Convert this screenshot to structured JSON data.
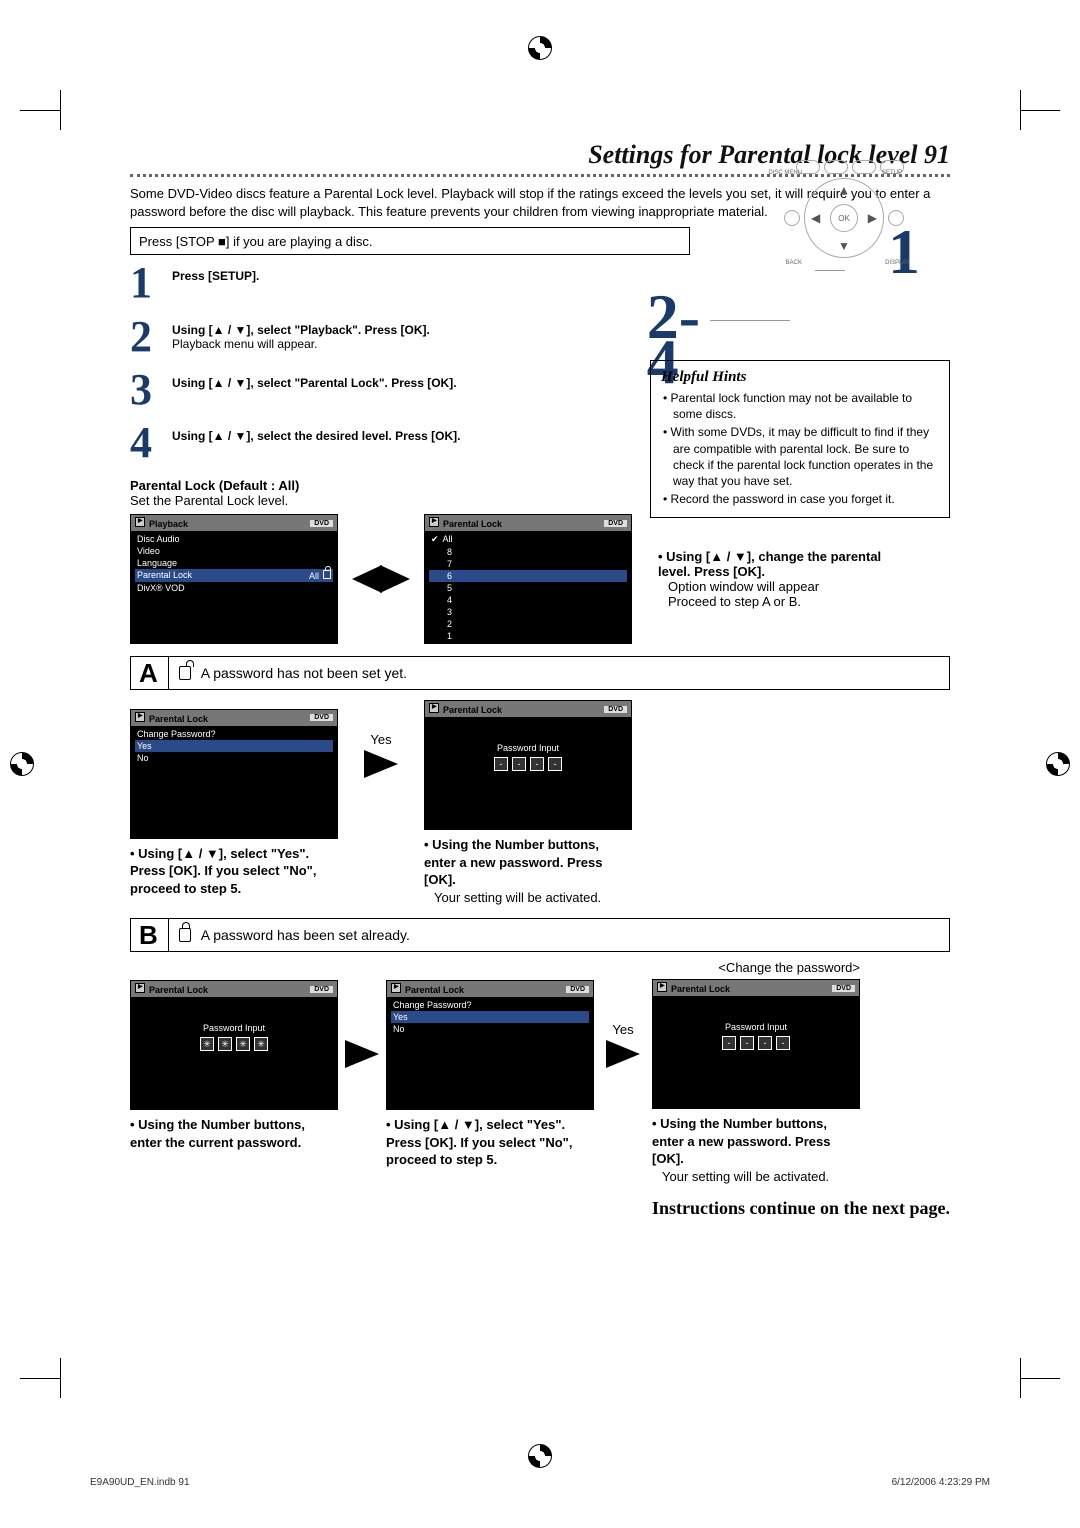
{
  "page_title": "Settings for Parental lock level  91",
  "intro": "Some DVD-Video discs feature a Parental Lock level. Playback will stop if the ratings exceed the levels you set, it will require you to enter a password before the disc will playback. This feature prevents your children from viewing inappropriate material.",
  "step_header": "Press [STOP ■] if you are playing a disc.",
  "steps": {
    "s1": {
      "num": "1",
      "title": "Press [SETUP].",
      "body": ""
    },
    "s2": {
      "num": "2",
      "title": "Using [▲ / ▼], select \"Playback\". Press [OK].",
      "body": "Playback menu will appear."
    },
    "s3": {
      "num": "3",
      "title": "Using [▲ / ▼], select \"Parental Lock\". Press [OK].",
      "body": ""
    },
    "s4": {
      "num": "4",
      "title": "Using [▲ / ▼], select the desired level. Press [OK].",
      "body": ""
    }
  },
  "big_one": "1",
  "big_24": "2-4",
  "remote": {
    "disc_menu": "DISC MENU",
    "setup": "SETUP",
    "ok": "OK",
    "back": "BACK",
    "display": "DISPLAY"
  },
  "default_head": "Parental Lock (Default : All)",
  "default_sub": "Set the Parental Lock level.",
  "osd": {
    "playback_title": "Playback",
    "dvd": "DVD",
    "playback_items": [
      "Disc Audio",
      "Video",
      "Language",
      "Parental Lock",
      "DivX® VOD"
    ],
    "playback_value": "All",
    "parental_title": "Parental Lock",
    "levels": [
      "All",
      "8",
      "7",
      "6",
      "5",
      "4",
      "3",
      "2",
      "1"
    ],
    "change_pw": "Change Password?",
    "yes": "Yes",
    "no": "No",
    "pw_input": "Password Input"
  },
  "arrow_label_yes": "Yes",
  "hints": {
    "title": "Helpful Hints",
    "i1": "Parental lock function may not be available to some discs.",
    "i2": "With some DVDs, it may be difficult to find if they are compatible with parental lock. Be sure to check if the parental lock function operates in the way that you have set.",
    "i3": "Record the password in case you forget it."
  },
  "side_note": {
    "l1": "Using [▲ / ▼], change the parental level. Press [OK].",
    "l2": "Option window will appear",
    "l3": "Proceed to step A or B."
  },
  "ab_a_title": "A password has not been set yet.",
  "ab_b_title": "A password has been set already.",
  "caption_a1_l1": "Using [▲ / ▼], select \"Yes\". Press [OK]. If you select \"No\", proceed to step 5.",
  "caption_a2_l1": "Using the Number buttons, enter a new password. Press [OK].",
  "caption_a2_l2": "Your setting will be activated.",
  "caption_b1": "Using the Number buttons, enter the current password.",
  "caption_b2": "Using [▲ / ▼], select \"Yes\". Press [OK]. If you select \"No\", proceed to step 5.",
  "caption_b3_l1": "Using the Number buttons, enter a new password. Press [OK].",
  "caption_b3_l2": "Your setting will be activated.",
  "change_pw_lbl": "<Change the password>",
  "next_page": "Instructions continue on the next page.",
  "footer_left": "E9A90UD_EN.indb   91",
  "footer_right": "6/12/2006   4:23:29 PM",
  "pw_masked": "✳",
  "pw_dash": "-"
}
